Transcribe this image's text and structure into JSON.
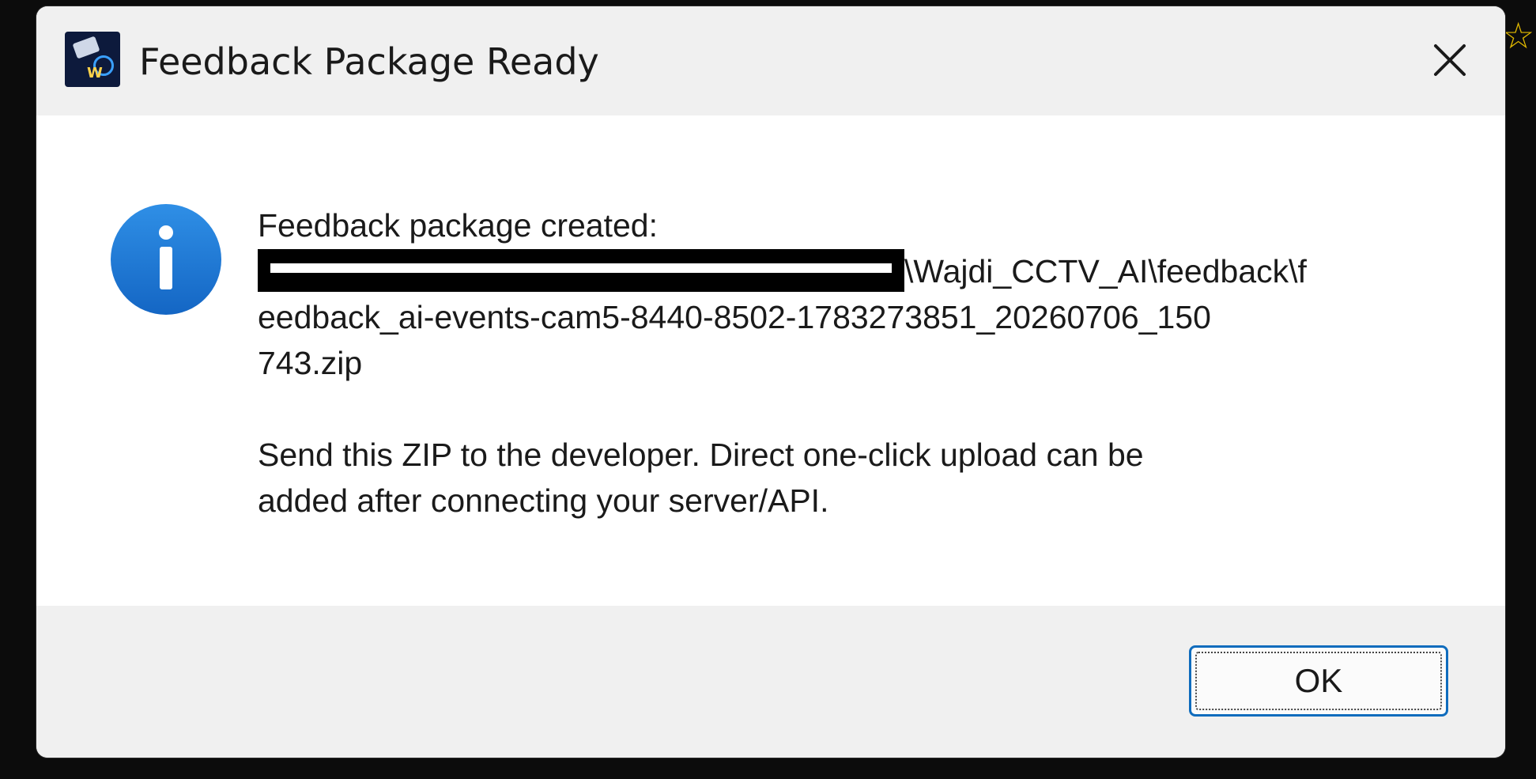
{
  "dialog": {
    "title": "Feedback Package Ready",
    "icon": "app-cctv-icon",
    "close_icon": "close-icon"
  },
  "message": {
    "icon": "info-icon",
    "heading": "Feedback package created:",
    "path_visible_part": "\\Wajdi_CCTV_AI\\feedback\\f",
    "path_line2": "eedback_ai-events-cam5-8440-8502-1783273851_20260706_150",
    "path_line3": "743.zip",
    "body_line1": "Send this ZIP to the developer. Direct one-click upload can be",
    "body_line2": "added after connecting your server/API."
  },
  "buttons": {
    "ok_label": "OK"
  },
  "colors": {
    "accent": "#0f6cbd",
    "info_blue": "#1a78d6",
    "titlebar_bg": "#f0f0f0"
  }
}
